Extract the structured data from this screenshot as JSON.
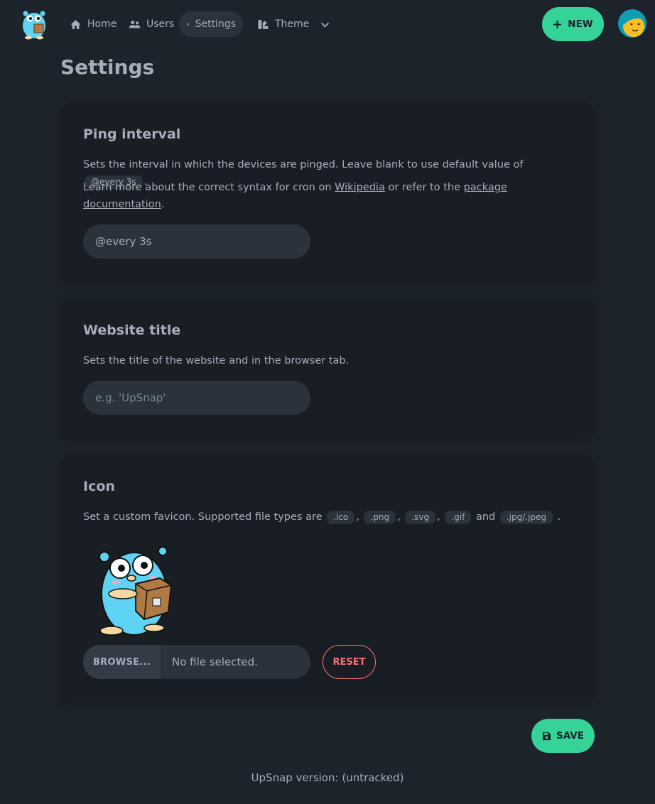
{
  "nav": {
    "home": "Home",
    "users": "Users",
    "settings": "Settings",
    "theme": "Theme",
    "new_button": "NEW"
  },
  "page": {
    "title": "Settings"
  },
  "ping": {
    "title": "Ping interval",
    "desc_prefix": "Sets the interval in which the devices are pinged. Leave blank to use default value of",
    "default_value": "@every 3s",
    "desc_suffix": ".",
    "learn_prefix": "Learn more about the correct syntax for cron on",
    "wikipedia_link": "Wikipedia",
    "learn_middle": "or refer to the",
    "package_link": "package documentation",
    "learn_suffix": ".",
    "input_value": "@every 3s"
  },
  "website_title": {
    "title": "Website title",
    "desc": "Sets the title of the website and in the browser tab.",
    "placeholder": "e.g. 'UpSnap'"
  },
  "icon": {
    "title": "Icon",
    "desc_prefix": "Set a custom favicon. Supported file types are",
    "types": [
      ".ico",
      ".png",
      ".svg",
      ".gif",
      ".jpg/.jpeg"
    ],
    "and_word": "and",
    "browse_label": "BROWSE...",
    "file_status": "No file selected.",
    "reset_label": "RESET"
  },
  "save_label": "SAVE",
  "footer": {
    "version": "UpSnap version: (untracked)"
  },
  "colors": {
    "accent": "#36d399",
    "danger": "#f87272",
    "bg": "#1d232a",
    "card": "#191e24"
  },
  "icons": [
    "home-icon",
    "users-icon",
    "gear-icon",
    "palette-icon",
    "chevron-down-icon",
    "plus-icon",
    "save-icon"
  ]
}
